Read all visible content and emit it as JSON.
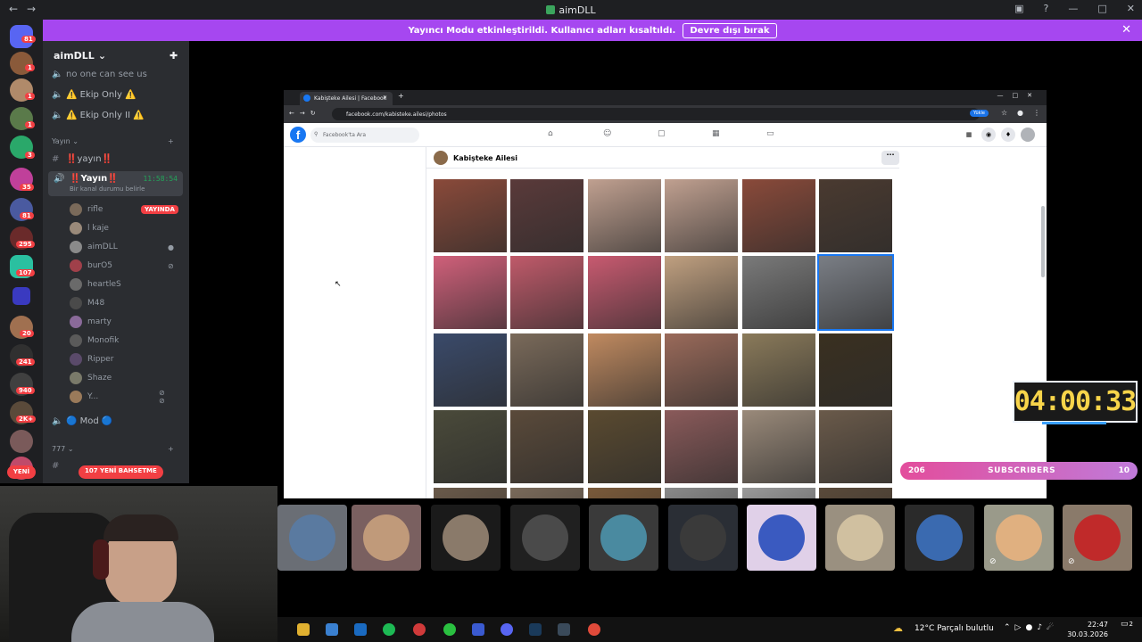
{
  "app": {
    "title": "aimDLL"
  },
  "banner": {
    "message": "Yayıncı Modu etkinleştirildi. Kullanıcı adları kısaltıldı.",
    "button": "Devre dışı bırak"
  },
  "rail": {
    "badges": [
      "81",
      "1",
      "1",
      "1",
      "3",
      "35",
      "81",
      "295",
      "107",
      "20",
      "241",
      "940",
      "2K+"
    ],
    "new_label": "YENİ"
  },
  "sidebar": {
    "server_name": "aimDLL",
    "channels": [
      {
        "label": "no one can see us"
      },
      {
        "label": "⚠️ Ekip Only ⚠️"
      },
      {
        "label": "⚠️ Ekip Only II ⚠️"
      }
    ],
    "category_yayin": "Yayın",
    "text_channel": "‼️yayın‼️",
    "voice_channel": "‼️Yayın‼️",
    "voice_timer": "11:58:54",
    "voice_status": "Bir kanal durumu belirle",
    "live_badge": "YAYINDA",
    "users": [
      "rifle",
      "l kaje",
      "aimDLL",
      "burO5",
      "heartleS",
      "M48",
      "marty",
      "Monofik",
      "Ripper",
      "Shaze",
      "Y..."
    ],
    "mod_channel": "🔵 Mod 🔵",
    "category_777": "777",
    "new_mentions": "107 YENİ BAHSETME"
  },
  "browser": {
    "tab_title": "Kabiştekе Ailesi | Facebook",
    "url": "facebook.com/kabisteke.ailesi/photos",
    "update_label": "Yükle",
    "search_placeholder": "Facebook'ta Ara",
    "page_name": "Kabişteke Ailesi",
    "more_label": "···"
  },
  "overlays": {
    "timer": "04:00:33",
    "subs_left": "206",
    "subs_label": "SUBSCRIBERS",
    "subs_right": "10"
  },
  "taskbar": {
    "weather": "12°C  Parçalı bulutlu",
    "time": "22:47",
    "date": "30.03.2026",
    "notifications": "2"
  },
  "colors": {
    "accent": "#a647f0",
    "facebook_blue": "#1877f2",
    "timer_yellow": "#f7d44a",
    "live_red": "#f23f43"
  }
}
